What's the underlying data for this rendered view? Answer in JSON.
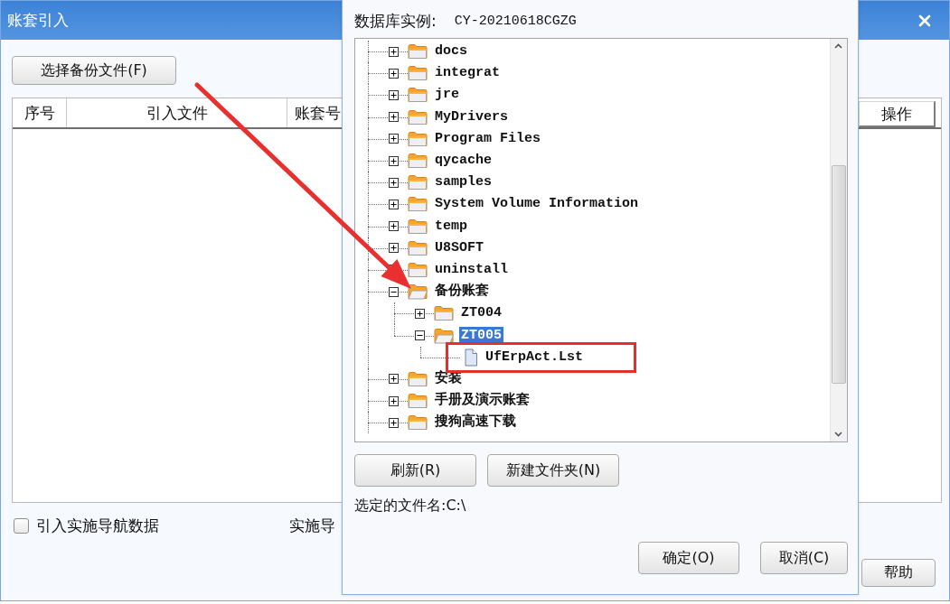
{
  "background_window": {
    "title": "账套引入",
    "select_button": "选择备份文件(F)",
    "table": {
      "columns": [
        "序号",
        "引入文件",
        "账套号",
        "操作"
      ]
    },
    "import_option": {
      "label": "引入实施导航数据",
      "checked": false
    },
    "covered_label": "实施导",
    "help_button": "帮助"
  },
  "folder_dialog": {
    "instance_label": "数据库实例:",
    "instance_value": "CY-20210618CGZG",
    "tree": [
      {
        "name": "docs",
        "kind": "folder",
        "expanded": false,
        "selected": false,
        "framed": false
      },
      {
        "name": "integrat",
        "kind": "folder",
        "expanded": false,
        "selected": false,
        "framed": false
      },
      {
        "name": "jre",
        "kind": "folder",
        "expanded": false,
        "selected": false,
        "framed": false
      },
      {
        "name": "MyDrivers",
        "kind": "folder",
        "expanded": false,
        "selected": false,
        "framed": false
      },
      {
        "name": "Program Files",
        "kind": "folder",
        "expanded": false,
        "selected": false,
        "framed": false
      },
      {
        "name": "qycache",
        "kind": "folder",
        "expanded": false,
        "selected": false,
        "framed": false
      },
      {
        "name": "samples",
        "kind": "folder",
        "expanded": false,
        "selected": false,
        "framed": false
      },
      {
        "name": "System Volume Information",
        "kind": "folder",
        "expanded": false,
        "selected": false,
        "framed": false
      },
      {
        "name": "temp",
        "kind": "folder",
        "expanded": false,
        "selected": false,
        "framed": false
      },
      {
        "name": "U8SOFT",
        "kind": "folder",
        "expanded": false,
        "selected": false,
        "framed": false
      },
      {
        "name": "uninstall",
        "kind": "folder",
        "expanded": false,
        "selected": false,
        "framed": false
      },
      {
        "name": "备份账套",
        "kind": "folder",
        "expanded": true,
        "selected": false,
        "framed": false,
        "children": [
          {
            "name": "ZT004",
            "kind": "folder",
            "expanded": false,
            "selected": false,
            "framed": false
          },
          {
            "name": "ZT005",
            "kind": "folder",
            "expanded": true,
            "selected": true,
            "framed": false,
            "children": [
              {
                "name": "UfErpAct.Lst",
                "kind": "file",
                "selected": false,
                "framed": true
              }
            ]
          }
        ]
      },
      {
        "name": "安装",
        "kind": "folder",
        "expanded": false,
        "selected": false,
        "framed": false
      },
      {
        "name": "手册及演示账套",
        "kind": "folder",
        "expanded": false,
        "selected": false,
        "framed": false
      },
      {
        "name": "搜狗高速下载",
        "kind": "folder",
        "expanded": false,
        "selected": false,
        "framed": false
      }
    ],
    "buttons": [
      "刷新(R)",
      "新建文件夹(N)"
    ],
    "selected_file": "选定的文件名:C:\\",
    "footer_buttons": [
      "确定(O)",
      "取消(C)"
    ]
  }
}
